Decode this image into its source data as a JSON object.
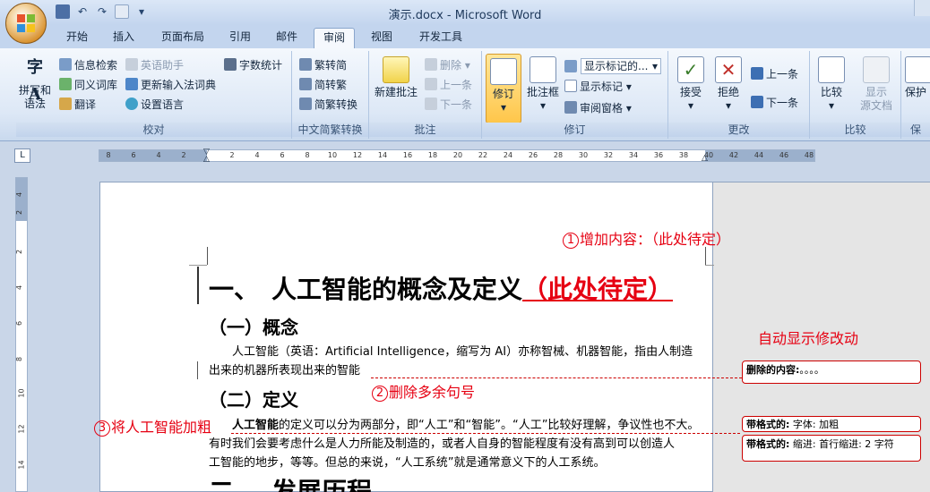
{
  "window": {
    "title": "演示.docx - Microsoft Word"
  },
  "tabs": [
    "开始",
    "插入",
    "页面布局",
    "引用",
    "邮件",
    "审阅",
    "视图",
    "开发工具"
  ],
  "active_tab": "审阅",
  "ribbon": {
    "proofing": {
      "label": "校对",
      "spell_label_1": "拼写和",
      "spell_label_2": "语法",
      "research": "信息检索",
      "thesaurus": "同义词库",
      "translate": "翻译",
      "english_assistant": "英语助手",
      "update_ime": "更新输入法词典",
      "set_language": "设置语言",
      "word_count": "字数统计"
    },
    "chinese_conversion": {
      "label": "中文简繁转换",
      "to_simplified": "繁转简",
      "to_traditional": "简转繁",
      "convert": "简繁转换"
    },
    "comments": {
      "label": "批注",
      "new_comment": "新建批注",
      "delete": "删除",
      "previous": "上一条",
      "next": "下一条"
    },
    "tracking": {
      "label": "修订",
      "track_changes": "修订",
      "balloons": "批注框",
      "display_dropdown": "显示标记的...",
      "show_markup": "显示标记",
      "reviewing_pane": "审阅窗格"
    },
    "changes": {
      "label": "更改",
      "accept": "接受",
      "reject": "拒绝",
      "previous": "上一条",
      "next": "下一条"
    },
    "compare": {
      "label": "比较",
      "compare": "比较",
      "show_source_1": "显示",
      "show_source_2": "源文档"
    },
    "protect": {
      "label": "保",
      "protect": "保护"
    }
  },
  "ruler": {
    "corner": "L",
    "ticks": [
      "8",
      "6",
      "4",
      "2",
      "2",
      "4",
      "6",
      "8",
      "10",
      "12",
      "14",
      "16",
      "18",
      "20",
      "22",
      "24",
      "26",
      "28",
      "30",
      "32",
      "34",
      "36",
      "38",
      "40",
      "42",
      "44",
      "46",
      "48"
    ],
    "vticks": [
      "4",
      "2",
      "2",
      "4",
      "6",
      "8",
      "10",
      "12",
      "14"
    ]
  },
  "document": {
    "heading1": "一、　人工智能的概念及定义",
    "heading1_inserted": "（此处待定）",
    "heading2a": "（一）概念",
    "para1_line1": "人工智能（英语：Artificial Intelligence，缩写为 AI）亦称智械、机器智能，指由人制造",
    "para1_line2": "出来的机器所表现出来的智能",
    "heading2b": "（二）定义",
    "para2_bold": "人工智能",
    "para2_line1_rest": "的定义可以分为两部分，即“人工”和“智能”。“人工”比较好理解，争议性也不大。",
    "para2_line2": "有时我们会要考虑什么是人力所能及制造的，或者人自身的智能程度有没有高到可以创造人",
    "para2_line3": "工智能的地步，等等。但总的来说，“人工系统”就是通常意义下的人工系统。",
    "heading1_next": "二、　发展历程"
  },
  "annotations": {
    "a1_num": "1",
    "a1_text": "增加内容：（此处待定）",
    "a2_num": "2",
    "a2_text": "删除多余句号",
    "a3_num": "3",
    "a3_text": "将人工智能加粗",
    "auto_note": "自动显示修改动"
  },
  "balloons": {
    "deleted_label": "删除的内容:",
    "deleted_value": "。。。。",
    "format1_label": "带格式的:",
    "format1_value": "字体: 加粗",
    "format2_label": "带格式的:",
    "format2_value": "缩进: 首行缩进:  2 字符"
  },
  "colors": {
    "accent_red": "#e60012",
    "ribbon_bg": "#dde8f6",
    "selected_button": "#ffc64a"
  }
}
